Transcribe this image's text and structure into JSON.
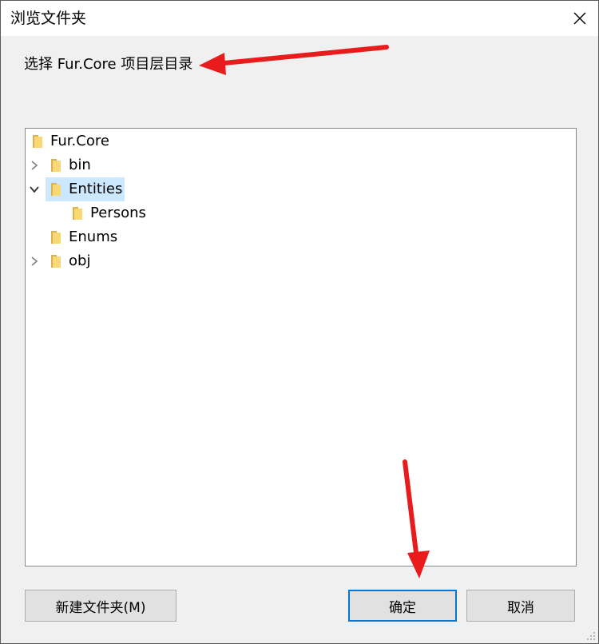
{
  "window": {
    "title": "浏览文件夹",
    "close_icon": "close-icon"
  },
  "instruction": "选择 Fur.Core 项目层目录",
  "tree": {
    "items": [
      {
        "label": "Fur.Core",
        "level": 0,
        "expander": "none",
        "selected": false
      },
      {
        "label": "bin",
        "level": 1,
        "expander": "collapsed",
        "selected": false
      },
      {
        "label": "Entities",
        "level": 1,
        "expander": "expanded",
        "selected": true
      },
      {
        "label": "Persons",
        "level": 2,
        "expander": "none",
        "selected": false
      },
      {
        "label": "Enums",
        "level": 1,
        "expander": "none",
        "selected": false
      },
      {
        "label": "obj",
        "level": 1,
        "expander": "collapsed",
        "selected": false
      }
    ]
  },
  "buttons": {
    "new_folder": "新建文件夹(M)",
    "ok": "确定",
    "cancel": "取消"
  },
  "colors": {
    "selection": "#cce8ff",
    "default_button_border": "#0078d7",
    "annotation_arrow": "#e81c1c",
    "folder": "#f5c842"
  }
}
